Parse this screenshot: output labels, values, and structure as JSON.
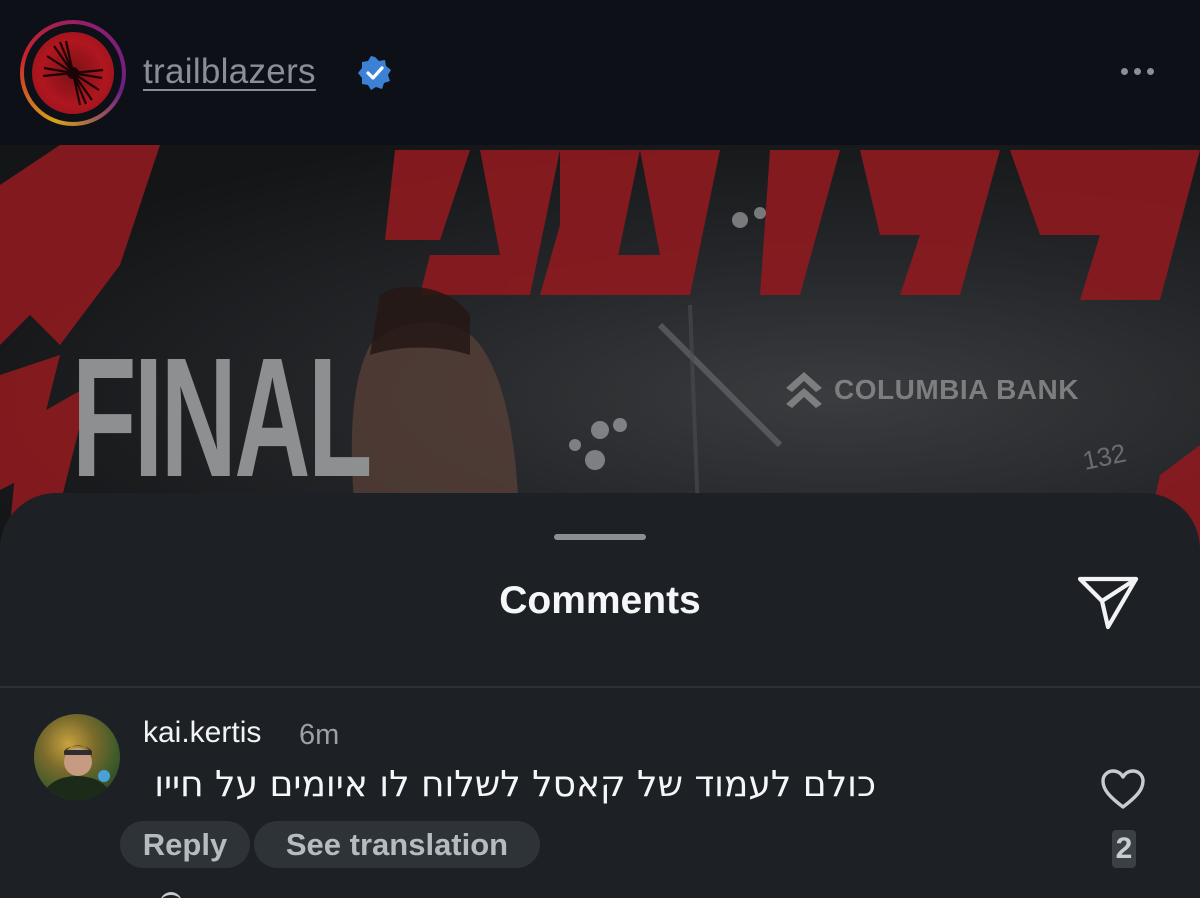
{
  "post": {
    "account_name": "trailblazers",
    "verified": true,
    "more_icon": "more-horizontal-icon",
    "image": {
      "headline": "FINAL",
      "sponsor": "COLUMBIA BANK"
    }
  },
  "comments_sheet": {
    "title": "Comments",
    "share_icon": "send-icon",
    "comments": [
      {
        "username": "kai.kertis",
        "time": "6m",
        "text": "כולם לעמוד של קאסל לשלוח לו איומים על חייו",
        "reply_label": "Reply",
        "translate_label": "See translation",
        "likes": "2"
      }
    ]
  },
  "colors": {
    "background": "#0d1117",
    "sheet": "#1d2125",
    "brand_red": "#c7222b",
    "verified_blue": "#3b82d6"
  }
}
